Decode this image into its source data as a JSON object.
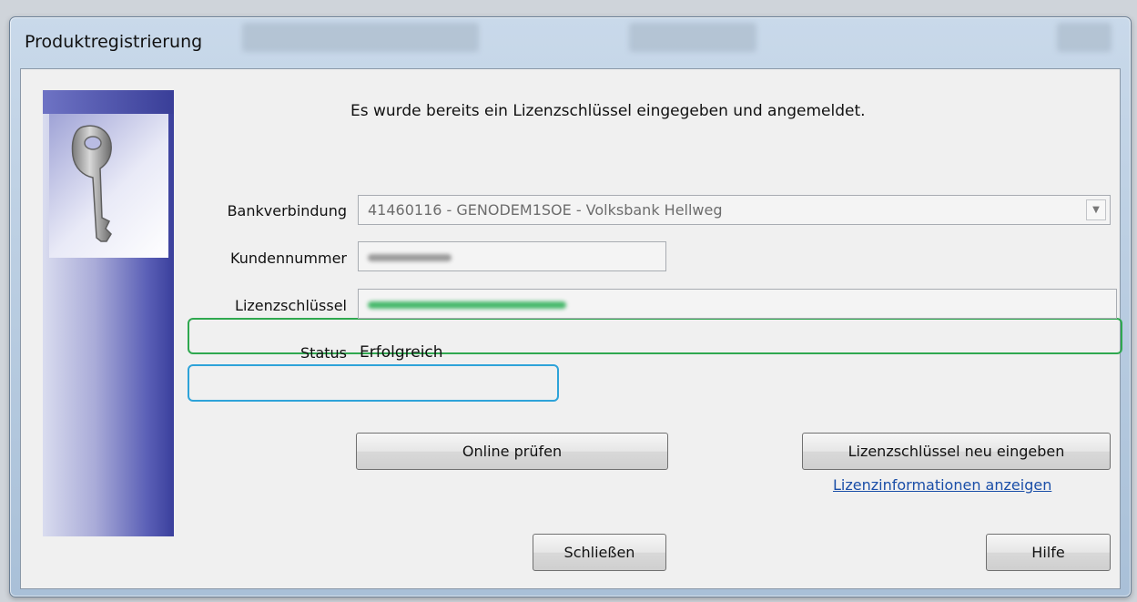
{
  "window": {
    "title": "Produktregistrierung"
  },
  "message": "Es wurde bereits ein Lizenzschlüssel eingegeben und angemeldet.",
  "form": {
    "bank_label": "Bankverbindung",
    "bank_value": "41460116 - GENODEM1SOE - Volksbank Hellweg",
    "customer_label": "Kundennummer",
    "license_label": "Lizenzschlüssel",
    "status_label": "Status",
    "status_value": "Erfolgreich"
  },
  "buttons": {
    "check_online": "Online prüfen",
    "reenter_key": "Lizenzschlüssel neu eingeben",
    "close": "Schließen",
    "help": "Hilfe"
  },
  "links": {
    "license_info": "Lizenzinformationen anzeigen"
  },
  "icons": {
    "sidebar": "key-icon",
    "combo": "chevron-down-icon"
  },
  "colors": {
    "highlight_license": "#2fa84f",
    "highlight_status": "#2ea3d9",
    "link": "#1a4ea8"
  }
}
